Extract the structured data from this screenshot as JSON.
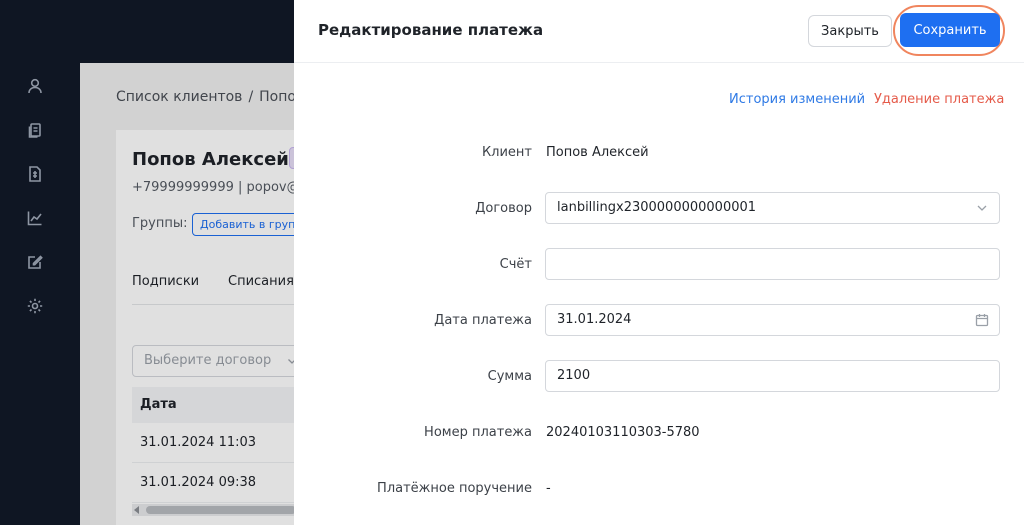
{
  "background": {
    "breadcrumb": {
      "root": "Список клиентов",
      "separator": "/",
      "current": "Попов"
    },
    "client": {
      "name": "Попов Алексей",
      "contact": "+79999999999  |  popov@"
    },
    "groups": {
      "label": "Группы:",
      "add_button": "Добавить в групп"
    },
    "tabs": [
      {
        "label": "Подписки"
      },
      {
        "label": "Списания"
      }
    ],
    "contract_select": {
      "placeholder": "Выберите договор"
    },
    "table": {
      "header": "Дата",
      "rows": [
        {
          "date": "31.01.2024 11:03"
        },
        {
          "date": "31.01.2024 09:38"
        }
      ]
    }
  },
  "drawer": {
    "title": "Редактирование платежа",
    "close_label": "Закрыть",
    "save_label": "Сохранить",
    "history_link": "История изменений",
    "delete_link": "Удаление платежа",
    "fields": {
      "client": {
        "label": "Клиент",
        "value": "Попов Алексей"
      },
      "contract": {
        "label": "Договор",
        "value": "lanbillingx2300000000000001"
      },
      "account": {
        "label": "Счёт",
        "value": ""
      },
      "payment_date": {
        "label": "Дата платежа",
        "value": "31.01.2024"
      },
      "amount": {
        "label": "Сумма",
        "value": "2100"
      },
      "payment_number": {
        "label": "Номер платежа",
        "value": "20240103110303-5780"
      },
      "payment_order": {
        "label": "Платёжное поручение",
        "value": "-"
      }
    }
  },
  "colors": {
    "primary": "#1e6ff1",
    "danger_link": "#e55b4a",
    "highlight_ring": "#f0855e",
    "nav_bg": "#0f1623"
  },
  "icons": {
    "nav": [
      "user-icon",
      "copy-icon",
      "document-icon",
      "chart-line-icon",
      "edit-icon",
      "gear-icon"
    ]
  }
}
